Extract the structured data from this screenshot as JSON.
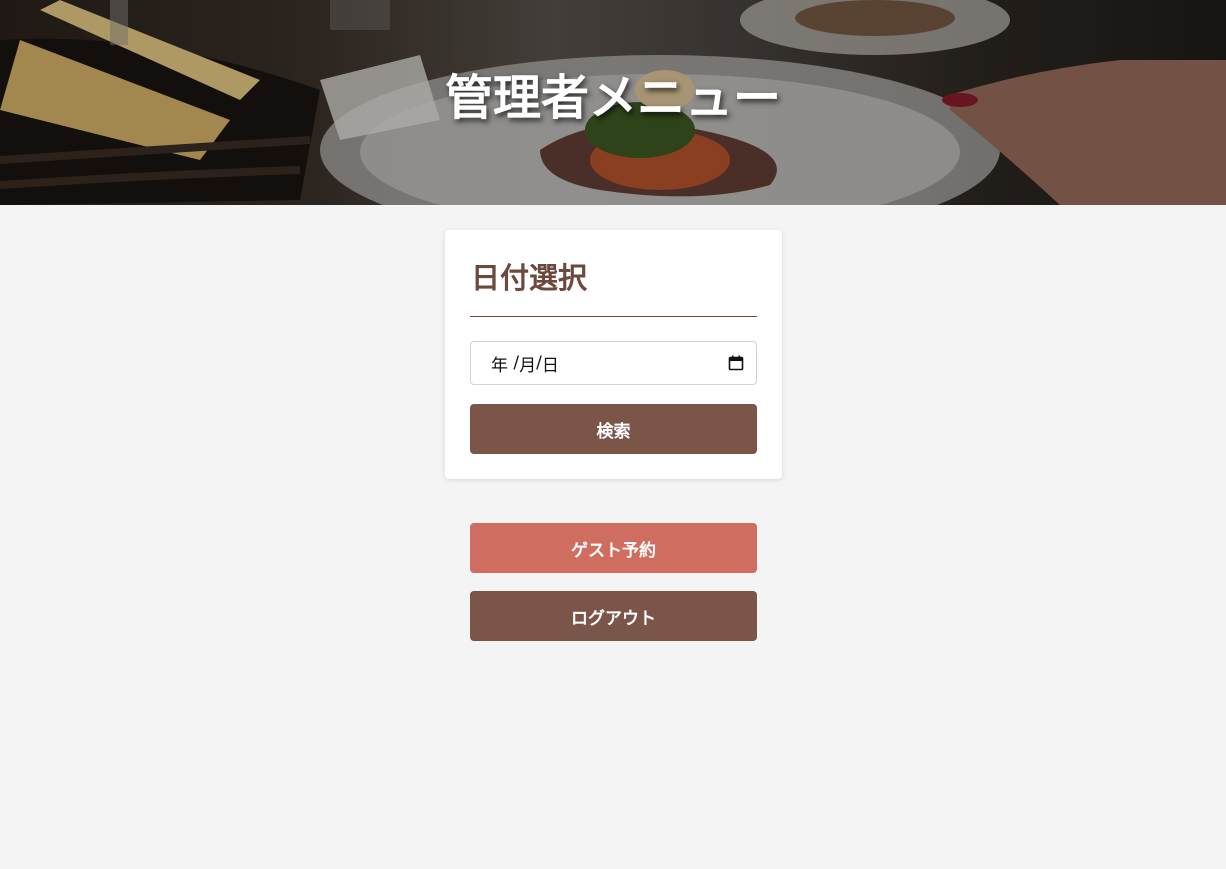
{
  "header": {
    "title": "管理者メニュー"
  },
  "date_card": {
    "title": "日付選択",
    "date_input": {
      "year_placeholder": "年",
      "month_placeholder": "月",
      "day_placeholder": "日"
    },
    "search_label": "検索"
  },
  "actions": {
    "guest_reservation_label": "ゲスト予約",
    "logout_label": "ログアウト"
  },
  "colors": {
    "primary_brown": "#7b5548",
    "accent_coral": "#cf6d60",
    "title_brown": "#6b4a3d",
    "background": "#f4f4f4"
  }
}
